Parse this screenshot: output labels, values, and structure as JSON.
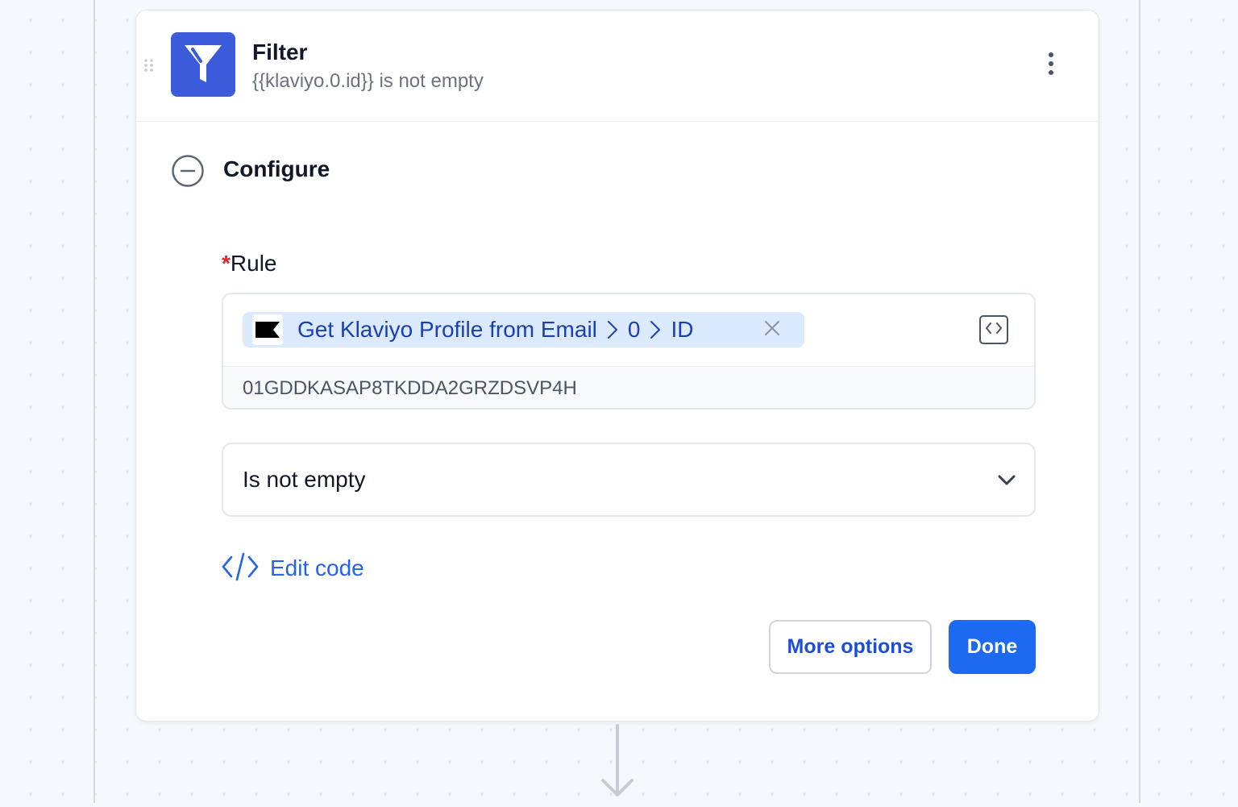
{
  "step": {
    "title": "Filter",
    "subtitle": "{{klaviyo.0.id}} is not empty",
    "icon": "filter-funnel-icon",
    "icon_color": "#3b5bdb"
  },
  "configure": {
    "title": "Configure",
    "toggle_icon": "collapse-minus-circle-icon"
  },
  "rule": {
    "required_marker": "*",
    "label": "Rule",
    "pill": {
      "app_icon": "klaviyo-flag-icon",
      "step_name": "Get Klaviyo Profile from Email",
      "path": [
        "0",
        "ID"
      ],
      "background": "#dbeafe",
      "text_color": "#1e40af"
    },
    "resolved_value": "01GDDKASAP8TKDDA2GRZDSVP4H"
  },
  "condition": {
    "selected": "Is not empty"
  },
  "edit_code": {
    "label": "Edit code",
    "icon": "code-brackets-icon"
  },
  "actions": {
    "more_options": "More options",
    "done": "Done",
    "primary_color": "#1d6af0"
  }
}
